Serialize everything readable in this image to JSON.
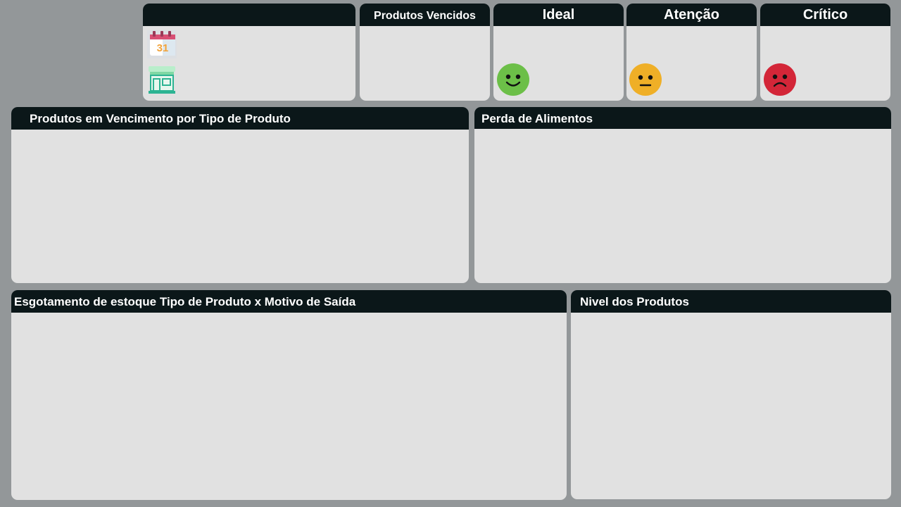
{
  "colors": {
    "background": "#939799",
    "card": "#e1e1e1",
    "header": "#0b1719",
    "ideal": "#6cbf48",
    "atencao": "#efaf27",
    "critico": "#d32638"
  },
  "filter_card": {
    "title": "",
    "icons": [
      "calendar-icon",
      "store-icon"
    ],
    "calendar_day": "31"
  },
  "kpis": {
    "vencidos": {
      "title": "Produtos Vencidos"
    },
    "ideal": {
      "title": "Ideal",
      "icon": "happy-face-icon"
    },
    "atencao": {
      "title": "Atenção",
      "icon": "neutral-face-icon"
    },
    "critico": {
      "title": "Crítico",
      "icon": "sad-face-icon"
    }
  },
  "panels": {
    "vencimento": {
      "title": "Produtos em Vencimento por Tipo de Produto"
    },
    "perda": {
      "title": "Perda de Alimentos"
    },
    "esgotamento": {
      "title": "Esgotamento de estoque Tipo de Produto x Motivo de Saída"
    },
    "nivel": {
      "title": "Nivel dos Produtos"
    }
  }
}
